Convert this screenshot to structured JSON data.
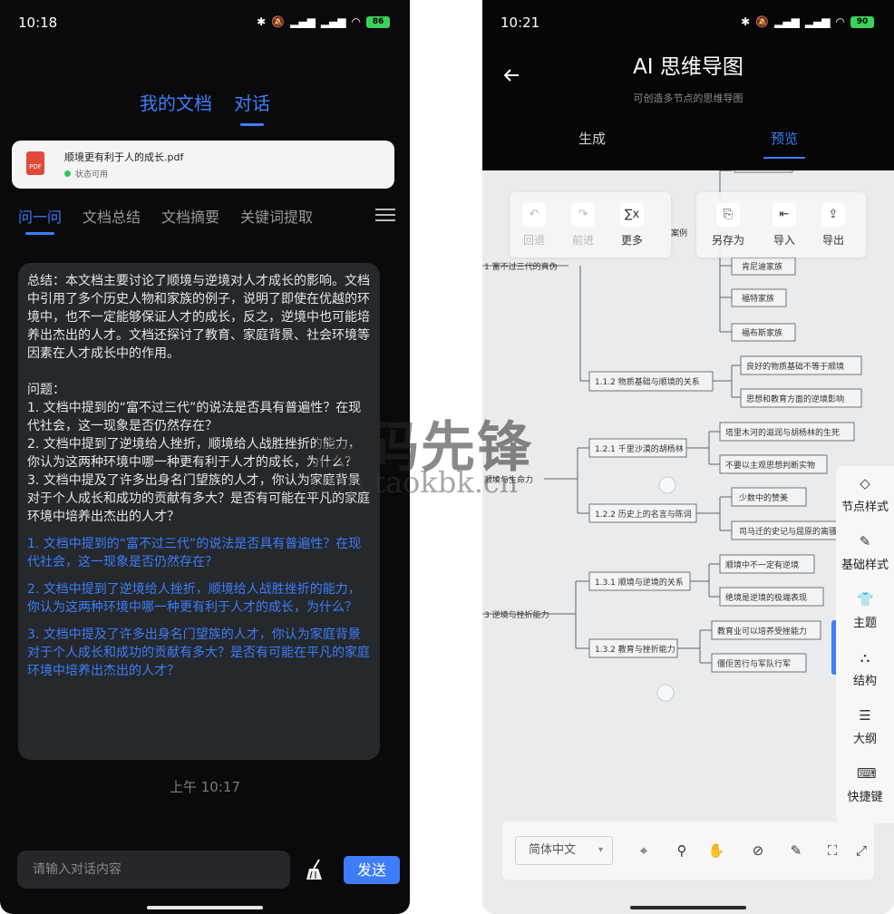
{
  "left": {
    "status": {
      "time": "10:18",
      "battery": "86"
    },
    "top_tabs": [
      "我的文档",
      "对话"
    ],
    "file": {
      "name": "顺境更有利于人的成长.pdf",
      "status": "状态可用",
      "icon_text": "PDF"
    },
    "sub_tabs": [
      "问一问",
      "文档总结",
      "文档摘要",
      "关键词提取"
    ],
    "message": {
      "summary": "总结：本文档主要讨论了顺境与逆境对人才成长的影响。文档中引用了多个历史人物和家族的例子，说明了即使在优越的环境中，也不一定能够保证人才的成长，反之，逆境中也可能培养出杰出的人才。文档还探讨了教育、家庭背景、社会环境等因素在人才成长中的作用。",
      "questions_title": "问题：",
      "questions": [
        "1. 文档中提到的“富不过三代”的说法是否具有普遍性？在现代社会，这一现象是否仍然存在？",
        "2. 文档中提到了逆境给人挫折，顺境给人战胜挫折的能力，你认为这两种环境中哪一种更有利于人才的成长，为什么？",
        "3. 文档中提及了许多出身名门望族的人才，你认为家庭背景对于个人成长和成功的贡献有多大？是否有可能在平凡的家庭环境中培养出杰出的人才？"
      ],
      "links": [
        "1. 文档中提到的“富不过三代”的说法是否具有普遍性？在现代社会，这一现象是否仍然存在？",
        "2. 文档中提到了逆境给人挫折，顺境给人战胜挫折的能力，你认为这两种环境中哪一种更有利于人才的成长，为什么？",
        "3. 文档中提及了许多出身名门望族的人才，你认为家庭背景对于个人成长和成功的贡献有多大？是否有可能在平凡的家庭环境中培养出杰出的人才？"
      ]
    },
    "timestamp": "上午 10:17",
    "input_placeholder": "请输入对话内容",
    "send_label": "发送"
  },
  "right": {
    "status": {
      "time": "10:21",
      "battery": "90"
    },
    "title": "AI 思维导图",
    "subtitle": "可创造多节点的思维导图",
    "tabs": [
      "生成",
      "预览"
    ],
    "toolbar_left": [
      "回退",
      "前进",
      "更多"
    ],
    "toolbar_right": [
      "另存为",
      "导入",
      "导出"
    ],
    "toolbar_icons": {
      "undo": "↶",
      "redo": "↷",
      "more": "∑x",
      "save_as": "⎘",
      "import": "⇤",
      "export": "⇪"
    },
    "side_panel": [
      "节点样式",
      "基础样式",
      "主题",
      "结构",
      "大纲",
      "快捷键"
    ],
    "side_icons": [
      "◇",
      "✎",
      "👕",
      "⛬",
      "☰",
      "⌨"
    ],
    "language": "简体中文",
    "bottom_icons": [
      "⌖",
      "⚲",
      "✋",
      "⊘",
      "✎",
      "⛶",
      "⤢"
    ],
    "mindmap": {
      "nodes": {
        "l1_1": "1 富不过三代的真伪",
        "l1_3": "3 逆境与挫折能力",
        "n_anli": "案例",
        "n_fam1": "肯尼迪家族",
        "n_fam2": "福特家族",
        "n_fam3": "福布斯家族",
        "n_112": "1.1.2 物质基础与顺境的关系",
        "n_112a": "良好的物质基础不等于顺境",
        "n_112b": "思想和教育方面的逆境影响",
        "n_121": "1.2.1 千里沙漠的胡杨林",
        "n_121a": "塔里木河的滋润与胡杨林的生死",
        "n_121b": "不要以主观思想判断实物",
        "n_12": "顺境与生命力",
        "n_122": "1.2.2 历史上的名言与陈词",
        "n_122a": "少数中的赞美",
        "n_122b": "司马迁的史记与屈原的离骚",
        "n_131": "1.3.1 顺境与逆境的关系",
        "n_131a": "顺境中不一定有逆境",
        "n_131b": "绝境是逆境的极端表现",
        "n_132": "1.3.2 教育与挫折能力",
        "n_132a": "教育业可以培养受挫能力",
        "n_132b": "僵佢苦行与军队行军"
      }
    }
  },
  "watermark": {
    "big": "探码先锋",
    "small": "app.taokbk.cn"
  }
}
